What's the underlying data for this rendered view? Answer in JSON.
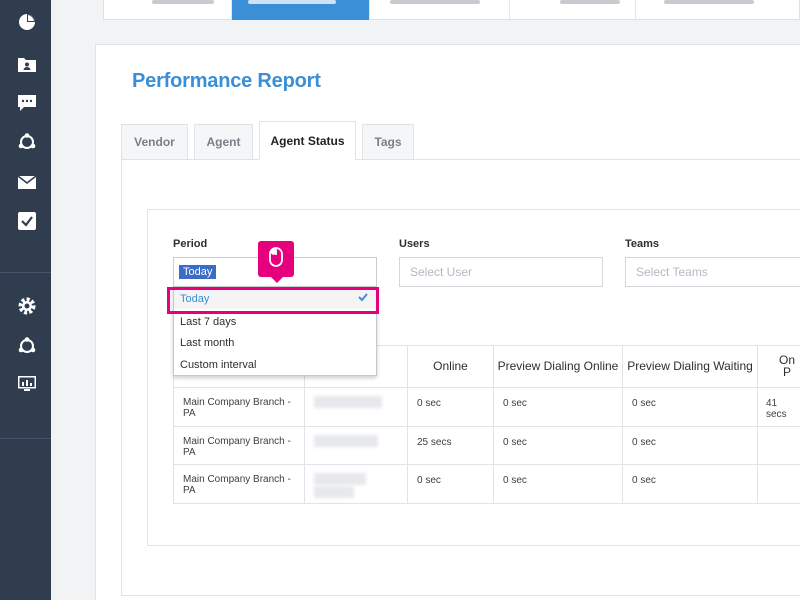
{
  "page": {
    "title": "Performance Report"
  },
  "tabs": [
    {
      "label": "Vendor"
    },
    {
      "label": "Agent"
    },
    {
      "label": "Agent Status"
    },
    {
      "label": "Tags"
    }
  ],
  "filters": {
    "period_label": "Period",
    "period_value": "Today",
    "users_label": "Users",
    "users_placeholder": "Select User",
    "teams_label": "Teams",
    "teams_placeholder": "Select Teams"
  },
  "dropdown": {
    "options": [
      "Today",
      "Last 7 days",
      "Last month",
      "Custom interval"
    ],
    "selected": "Today"
  },
  "table": {
    "headers": [
      "Online",
      "Preview Dialing Online",
      "Preview Dialing Waiting",
      "On P"
    ],
    "rows": [
      {
        "branch": "Main Company Branch - PA",
        "online": "0 sec",
        "pd_online": "0 sec",
        "pd_waiting": "0 sec",
        "on_p": "41 secs"
      },
      {
        "branch": "Main Company Branch - PA",
        "online": "25 secs",
        "pd_online": "0 sec",
        "pd_waiting": "0 sec",
        "on_p": ""
      },
      {
        "branch": "Main Company Branch - PA",
        "online": "0 sec",
        "pd_online": "0 sec",
        "pd_waiting": "0 sec",
        "on_p": ""
      }
    ]
  },
  "colors": {
    "sidebar": "#2f3d4f",
    "accent": "#3a8fd6",
    "highlight": "#e6007e"
  }
}
